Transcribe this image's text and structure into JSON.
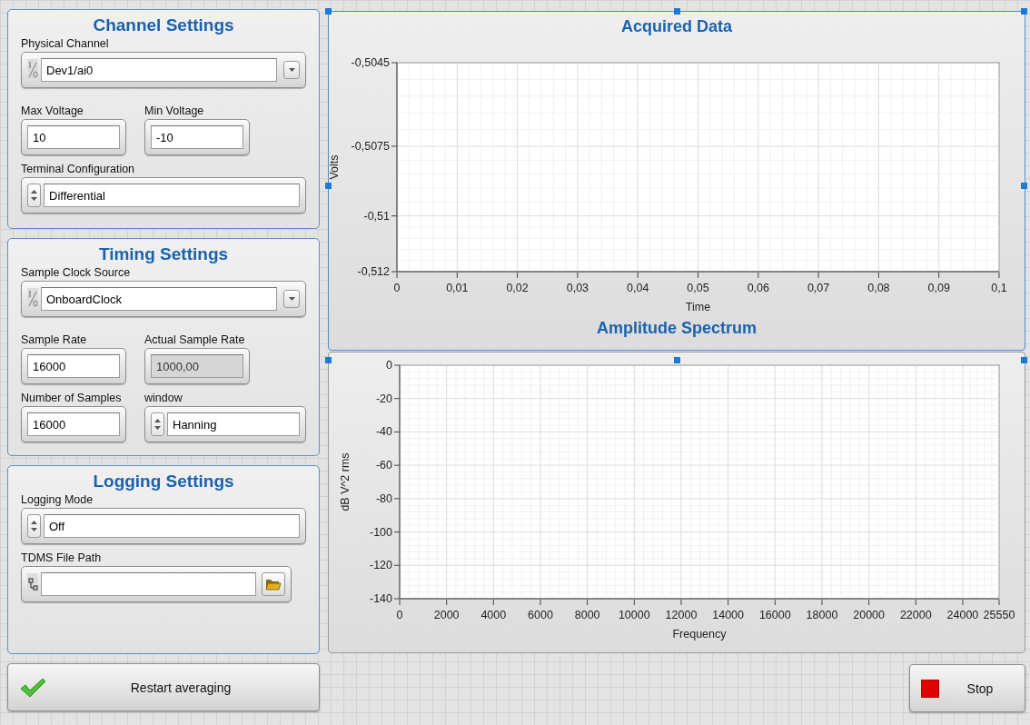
{
  "panels": [
    {
      "title": "Channel Settings",
      "rows": [
        [
          {
            "kind": "combo",
            "label": "Physical Channel",
            "value": "Dev1/ai0",
            "disabled": false
          }
        ],
        [
          {
            "kind": "numeric",
            "label": "Max Voltage",
            "value": "10",
            "disabled": false
          },
          {
            "kind": "numeric",
            "label": "Min Voltage",
            "value": "-10",
            "disabled": false
          }
        ],
        [
          {
            "kind": "ring",
            "label": "Terminal Configuration",
            "value": "Differential",
            "disabled": false
          }
        ]
      ]
    },
    {
      "title": "Timing Settings",
      "rows": [
        [
          {
            "kind": "combo",
            "label": "Sample Clock Source",
            "value": "OnboardClock",
            "disabled": false
          }
        ],
        [
          {
            "kind": "numeric",
            "label": "Sample Rate",
            "value": "16000",
            "disabled": false
          },
          {
            "kind": "numeric",
            "label": "Actual Sample Rate",
            "value": "1000,00",
            "disabled": true
          }
        ],
        [
          {
            "kind": "numeric",
            "label": "Number of Samples",
            "value": "16000",
            "disabled": false
          },
          {
            "kind": "ring",
            "label": "window",
            "value": "Hanning",
            "disabled": false
          }
        ]
      ]
    },
    {
      "title": "Logging Settings",
      "rows": [
        [
          {
            "kind": "ring",
            "label": "Logging Mode",
            "value": "Off",
            "disabled": false
          }
        ],
        [
          {
            "kind": "path",
            "label": "TDMS File Path",
            "disabled": false
          }
        ]
      ]
    }
  ],
  "restart_button": {
    "label": "Restart averaging"
  },
  "graphs": [
    {
      "chart_data": {
        "type": "line",
        "grid": true,
        "title": "Acquired Data",
        "xlabel": "Time",
        "ylabel": "Volts",
        "xlim": [
          0,
          0.1
        ],
        "ylim": [
          -0.512,
          -0.5045
        ],
        "xticks": [
          {
            "value": 0,
            "label": "0"
          },
          {
            "value": 0.01,
            "label": "0,01"
          },
          {
            "value": 0.02,
            "label": "0,02"
          },
          {
            "value": 0.03,
            "label": "0,03"
          },
          {
            "value": 0.04,
            "label": "0,04"
          },
          {
            "value": 0.05,
            "label": "0,05"
          },
          {
            "value": 0.06,
            "label": "0,06"
          },
          {
            "value": 0.07,
            "label": "0,07"
          },
          {
            "value": 0.08,
            "label": "0,08"
          },
          {
            "value": 0.09,
            "label": "0,09"
          },
          {
            "value": 0.1,
            "label": "0,1"
          }
        ],
        "yticks": [
          {
            "value": -0.5045,
            "label": "-0,5045"
          },
          {
            "value": -0.5075,
            "label": "-0,5075"
          },
          {
            "value": -0.51,
            "label": "-0,51"
          },
          {
            "value": -0.512,
            "label": "-0,512"
          }
        ]
      }
    },
    {
      "chart_data": {
        "type": "line",
        "grid": true,
        "title": "Amplitude Spectrum",
        "xlabel": "Frequency",
        "ylabel": "dB V^2 rms",
        "xlim": [
          0,
          25550
        ],
        "ylim": [
          -140,
          0
        ],
        "xticks": [
          0,
          2000,
          4000,
          6000,
          8000,
          10000,
          12000,
          14000,
          16000,
          18000,
          20000,
          22000,
          24000,
          25550
        ],
        "yticks": [
          0,
          -20,
          -40,
          -60,
          -80,
          -100,
          -120,
          -140
        ]
      }
    }
  ],
  "stop_button": {
    "label": "Stop"
  }
}
